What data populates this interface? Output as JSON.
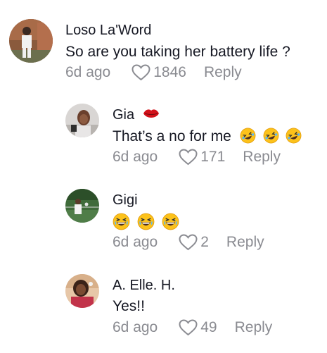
{
  "comments": [
    {
      "username": "Loso La'Word",
      "text": "So are you taking her battery life ?",
      "age": "6d ago",
      "likes": "1846",
      "reply_label": "Reply",
      "avatar": "user-photo"
    },
    {
      "username": "Gia",
      "username_emoji": "lips-emoji",
      "text": "That’s a no for me",
      "text_emojis": [
        "rolling-on-floor-laughing-emoji",
        "rolling-on-floor-laughing-emoji",
        "rolling-on-floor-laughing-emoji"
      ],
      "age": "6d ago",
      "likes": "171",
      "reply_label": "Reply",
      "avatar": "user-photo"
    },
    {
      "username": "Gigi",
      "text_emojis": [
        "grinning-squinting-sweat-emoji",
        "grinning-squinting-sweat-emoji",
        "grinning-squinting-sweat-emoji"
      ],
      "age": "6d ago",
      "likes": "2",
      "reply_label": "Reply",
      "avatar": "user-photo"
    },
    {
      "username": "A. Elle. H.",
      "text": "Yes!!",
      "age": "6d ago",
      "likes": "49",
      "reply_label": "Reply",
      "avatar": "user-photo"
    }
  ],
  "colors": {
    "primary_text": "#161823",
    "secondary_text": "#8a8b91"
  },
  "icons": {
    "like": "heart-outline-icon"
  }
}
